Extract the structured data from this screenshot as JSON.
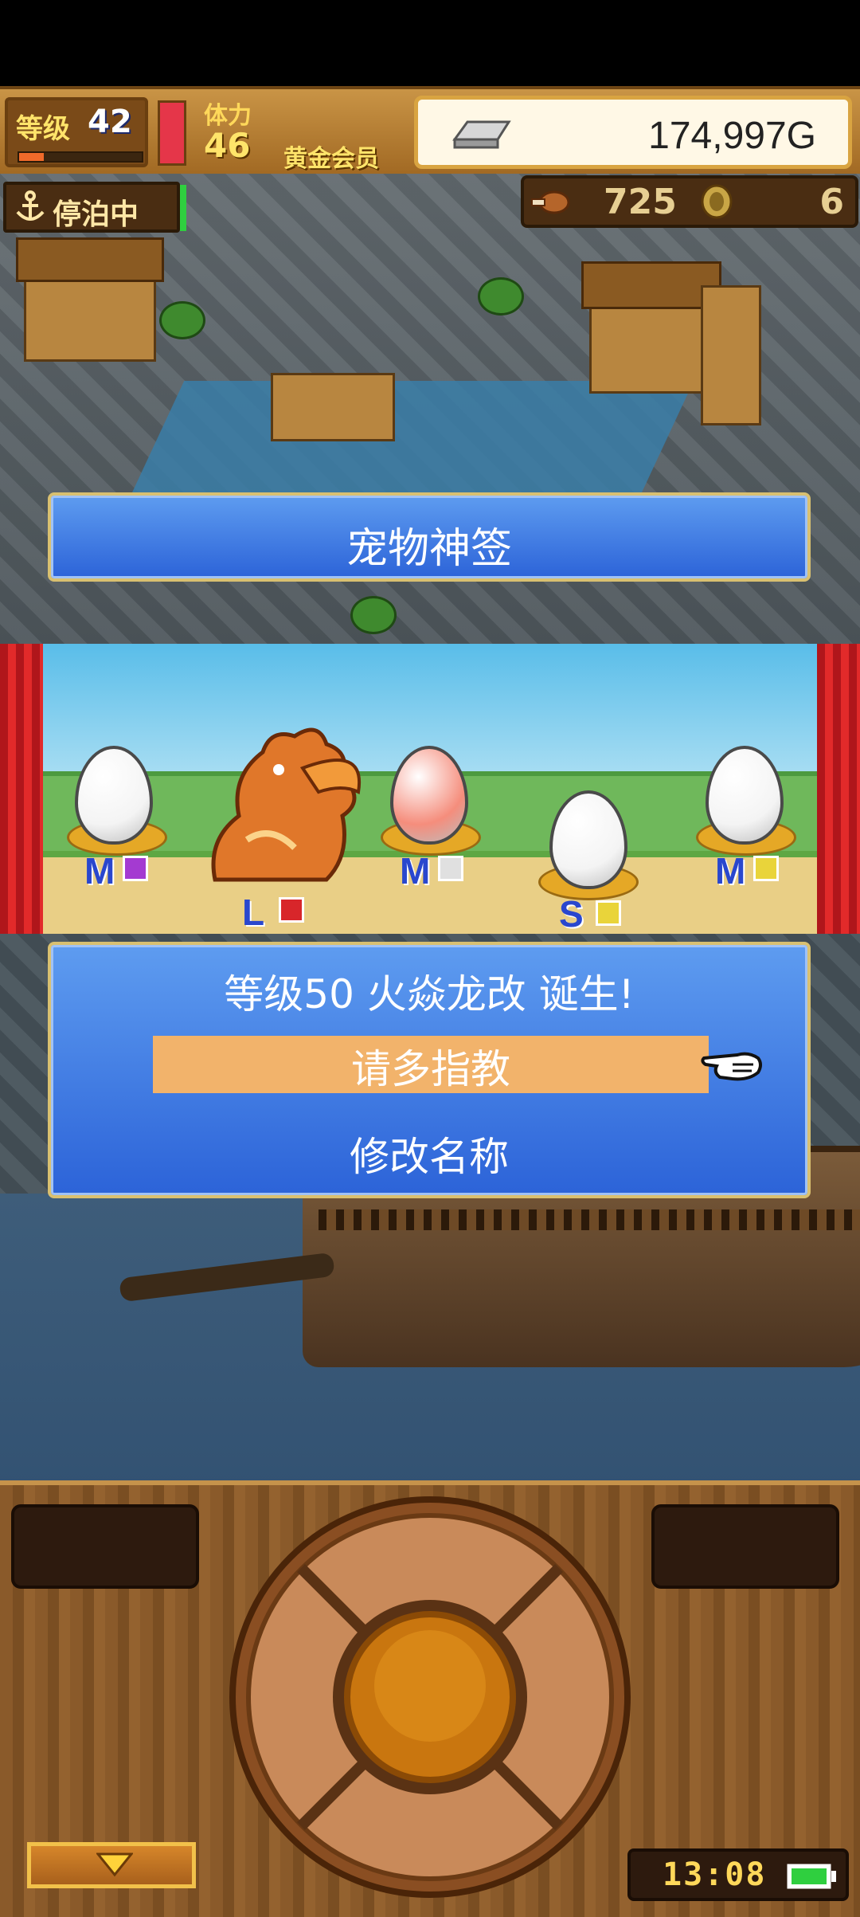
{
  "hud": {
    "level_label": "等级",
    "level_value": "42",
    "level_progress": 0.2,
    "stamina_label": "体力",
    "stamina_value": "46",
    "stamina_gauge_level": 1.0,
    "membership": "黄金会员",
    "gold": "174,997G"
  },
  "status": {
    "anchor_label": "停泊中",
    "food": "725",
    "medals": "6"
  },
  "title": "宠物神签",
  "pets": [
    {
      "size": "M",
      "egg_color": "#f4f4f4",
      "element_color": "#a43ad1"
    },
    {
      "size": "L",
      "egg_color": "dragon",
      "element_color": "#d8262a"
    },
    {
      "size": "M",
      "egg_color": "#f58d7c",
      "element_color": "#e0e0e0"
    },
    {
      "size": "S",
      "egg_color": "#f4f4f4",
      "element_color": "#e9d43a"
    },
    {
      "size": "M",
      "egg_color": "#f4f4f4",
      "element_color": "#e9d43a"
    }
  ],
  "dialog": {
    "message": "等级50 火焱龙改 诞生!",
    "choice_1": "请多指教",
    "choice_2": "修改名称"
  },
  "controller": {
    "clock": "13:08"
  },
  "colors": {
    "dialog_blue": "#3a78e2",
    "highlight": "#f2b36b",
    "gold_text": "#ffe46a"
  }
}
